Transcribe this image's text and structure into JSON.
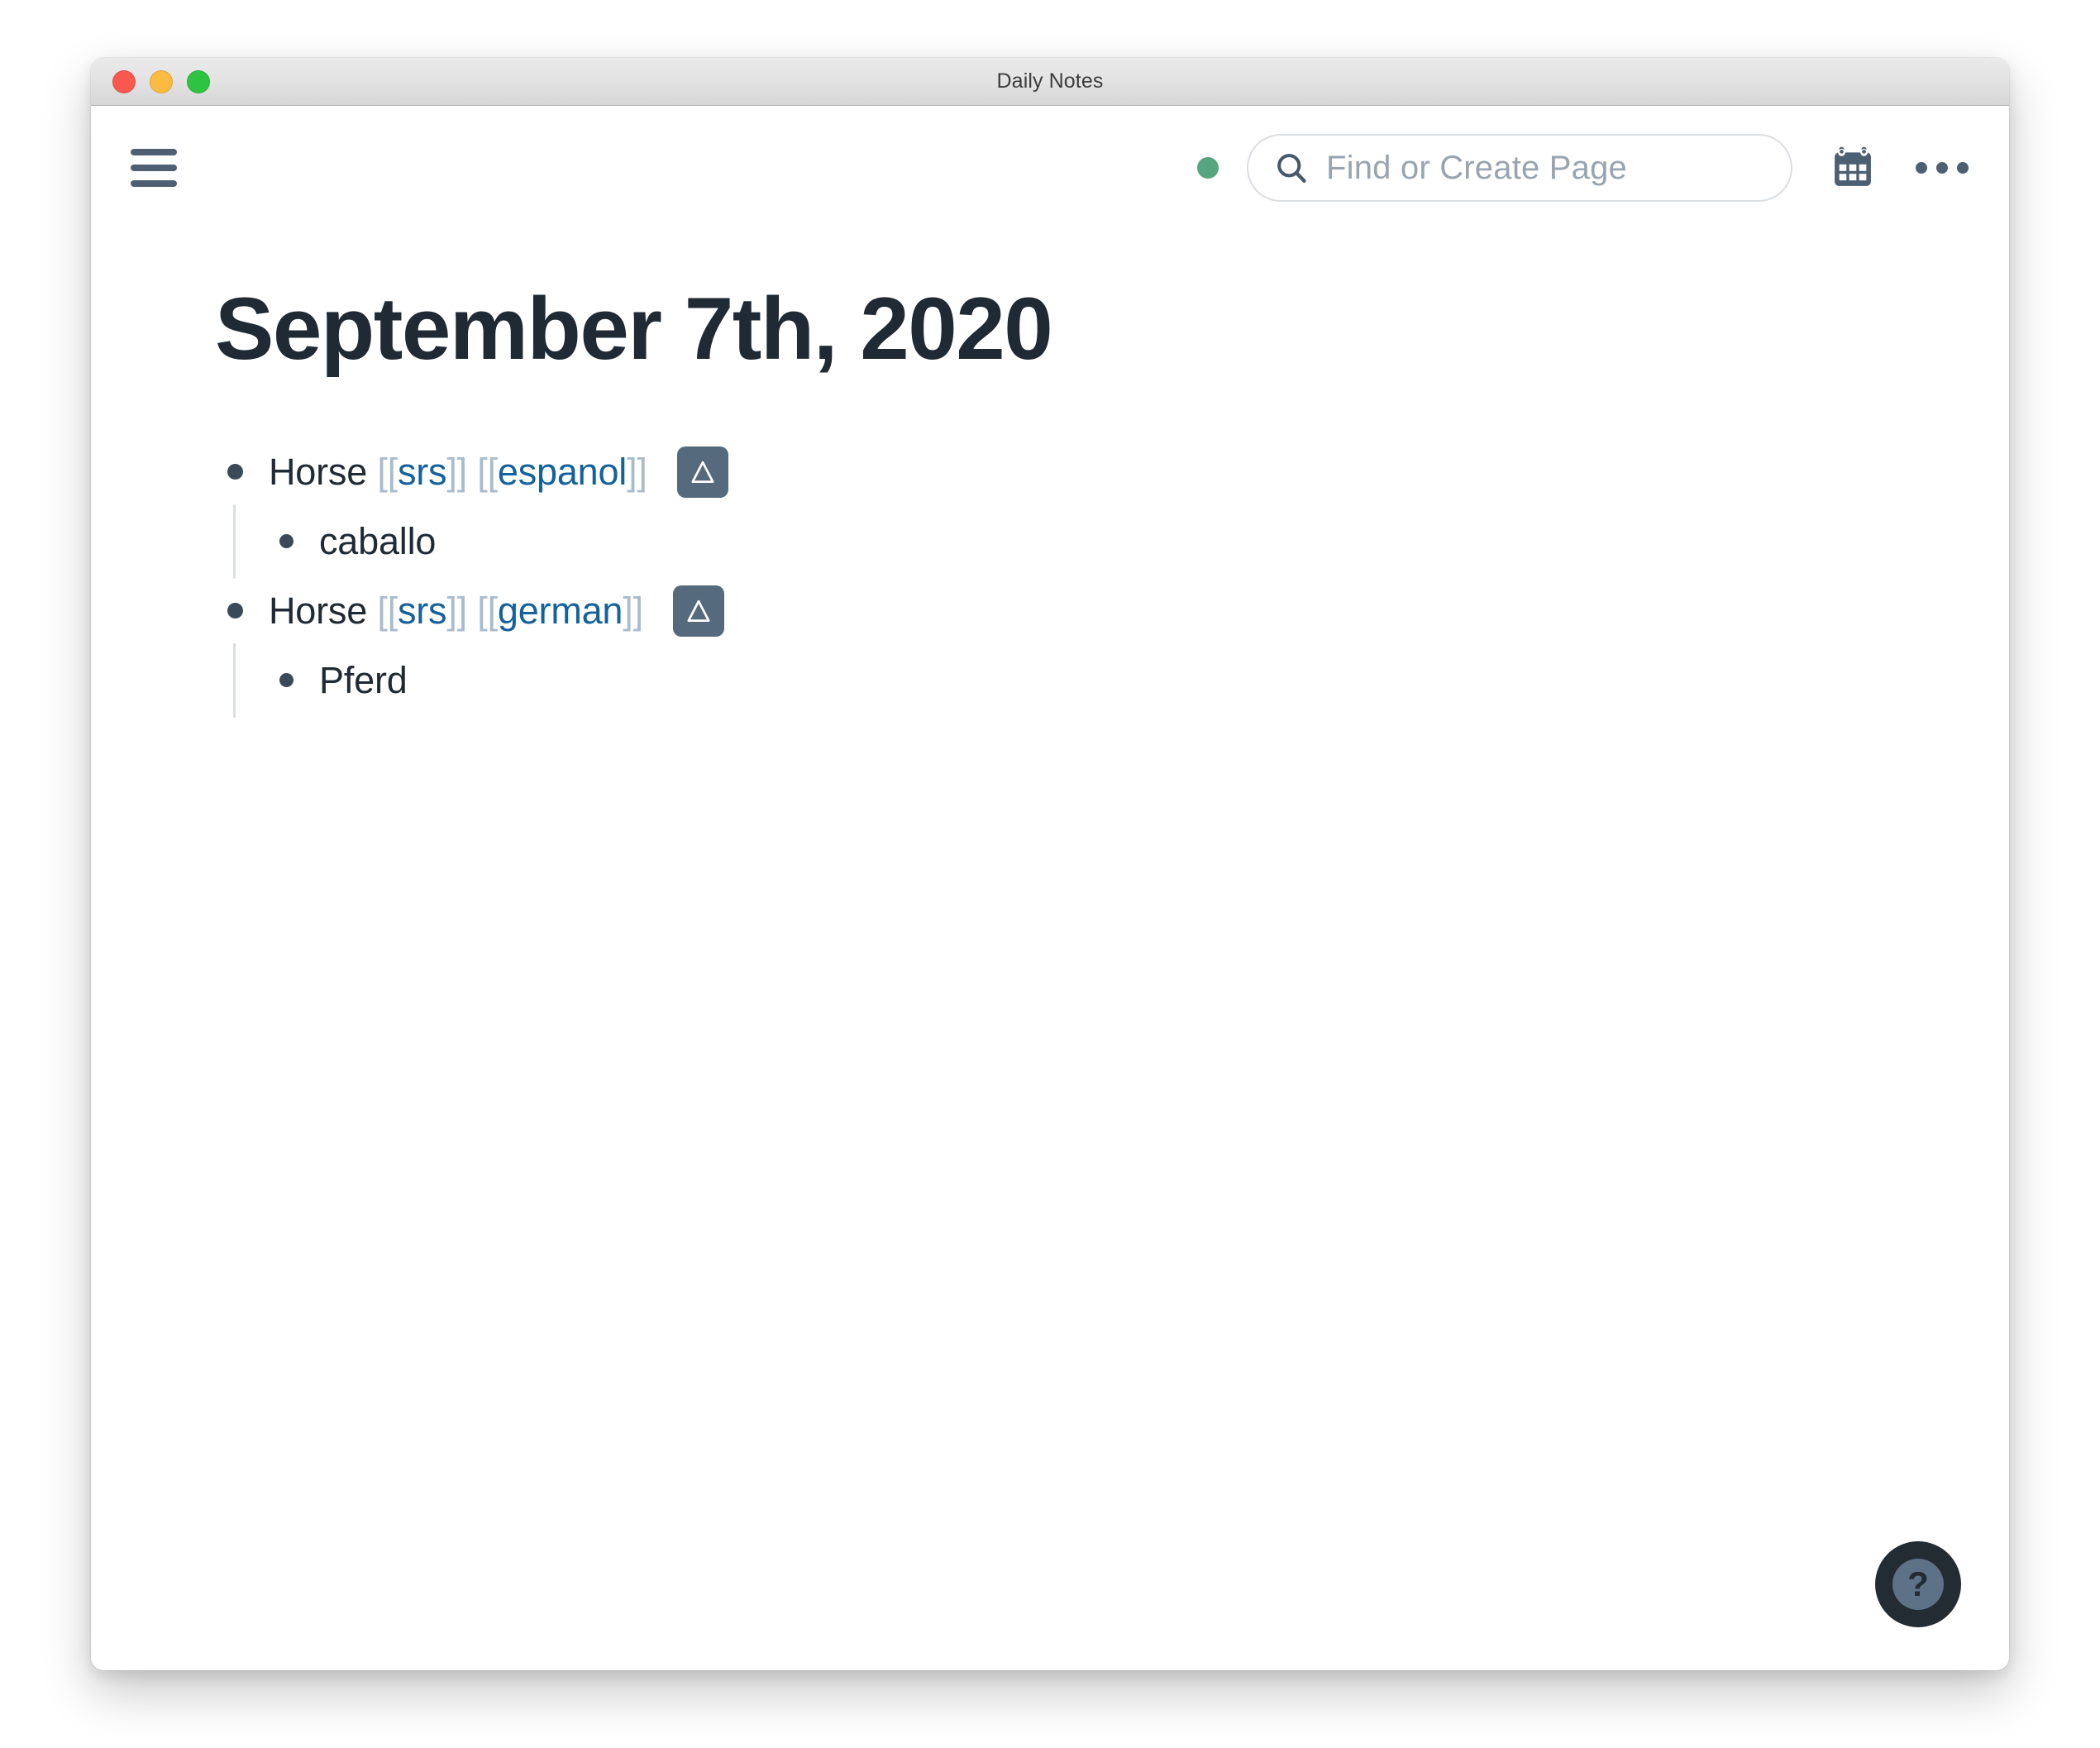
{
  "window": {
    "title": "Daily Notes",
    "traffic_lights": [
      {
        "name": "close",
        "color": "#f9584f"
      },
      {
        "name": "minimize",
        "color": "#fcbb40"
      },
      {
        "name": "maximize",
        "color": "#2ec342"
      }
    ]
  },
  "topbar": {
    "menu_icon": "hamburger-menu-icon",
    "status_dot": {
      "icon": "status-dot-icon",
      "color": "#55a581"
    },
    "search": {
      "icon": "search-icon",
      "value": "",
      "placeholder": "Find or Create Page"
    },
    "calendar_icon": "calendar-icon",
    "more_icon": "more-horizontal-icon"
  },
  "page": {
    "title": "September 7th, 2020",
    "blocks": [
      {
        "text_prefix": "Horse ",
        "tags": [
          {
            "open": "[[",
            "name": "srs",
            "close": "]]"
          },
          {
            "open": "[[",
            "name": "espanol",
            "close": "]]"
          }
        ],
        "button_label": "Δ",
        "button_color": "#566a7e",
        "children": [
          {
            "text": "caballo"
          }
        ]
      },
      {
        "text_prefix": "Horse ",
        "tags": [
          {
            "open": "[[",
            "name": "srs",
            "close": "]]"
          },
          {
            "open": "[[",
            "name": "german",
            "close": "]]"
          }
        ],
        "button_label": "Δ",
        "button_color": "#566a7e",
        "children": [
          {
            "text": "Pferd"
          }
        ]
      }
    ]
  },
  "help": {
    "icon": "question-mark-icon",
    "label": "?"
  },
  "colors": {
    "tag_link": "#15619d",
    "tag_brackets": "#a8bccd",
    "text": "#1f2a34",
    "slate": "#4d6073",
    "accent_green": "#55a581"
  }
}
